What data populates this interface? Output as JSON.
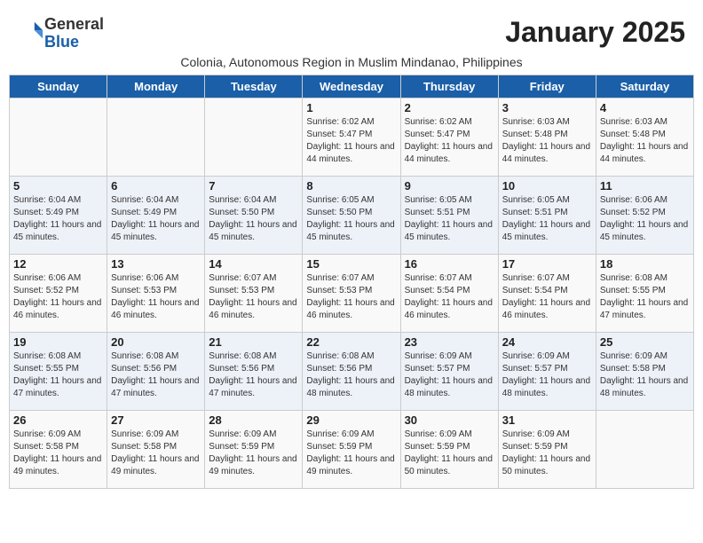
{
  "header": {
    "logo_line1": "General",
    "logo_line2": "Blue",
    "month_title": "January 2025",
    "subtitle": "Colonia, Autonomous Region in Muslim Mindanao, Philippines"
  },
  "weekdays": [
    "Sunday",
    "Monday",
    "Tuesday",
    "Wednesday",
    "Thursday",
    "Friday",
    "Saturday"
  ],
  "weeks": [
    [
      {
        "day": "",
        "sunrise": "",
        "sunset": "",
        "daylight": ""
      },
      {
        "day": "",
        "sunrise": "",
        "sunset": "",
        "daylight": ""
      },
      {
        "day": "",
        "sunrise": "",
        "sunset": "",
        "daylight": ""
      },
      {
        "day": "1",
        "sunrise": "6:02 AM",
        "sunset": "5:47 PM",
        "daylight": "11 hours and 44 minutes."
      },
      {
        "day": "2",
        "sunrise": "6:02 AM",
        "sunset": "5:47 PM",
        "daylight": "11 hours and 44 minutes."
      },
      {
        "day": "3",
        "sunrise": "6:03 AM",
        "sunset": "5:48 PM",
        "daylight": "11 hours and 44 minutes."
      },
      {
        "day": "4",
        "sunrise": "6:03 AM",
        "sunset": "5:48 PM",
        "daylight": "11 hours and 44 minutes."
      }
    ],
    [
      {
        "day": "5",
        "sunrise": "6:04 AM",
        "sunset": "5:49 PM",
        "daylight": "11 hours and 45 minutes."
      },
      {
        "day": "6",
        "sunrise": "6:04 AM",
        "sunset": "5:49 PM",
        "daylight": "11 hours and 45 minutes."
      },
      {
        "day": "7",
        "sunrise": "6:04 AM",
        "sunset": "5:50 PM",
        "daylight": "11 hours and 45 minutes."
      },
      {
        "day": "8",
        "sunrise": "6:05 AM",
        "sunset": "5:50 PM",
        "daylight": "11 hours and 45 minutes."
      },
      {
        "day": "9",
        "sunrise": "6:05 AM",
        "sunset": "5:51 PM",
        "daylight": "11 hours and 45 minutes."
      },
      {
        "day": "10",
        "sunrise": "6:05 AM",
        "sunset": "5:51 PM",
        "daylight": "11 hours and 45 minutes."
      },
      {
        "day": "11",
        "sunrise": "6:06 AM",
        "sunset": "5:52 PM",
        "daylight": "11 hours and 45 minutes."
      }
    ],
    [
      {
        "day": "12",
        "sunrise": "6:06 AM",
        "sunset": "5:52 PM",
        "daylight": "11 hours and 46 minutes."
      },
      {
        "day": "13",
        "sunrise": "6:06 AM",
        "sunset": "5:53 PM",
        "daylight": "11 hours and 46 minutes."
      },
      {
        "day": "14",
        "sunrise": "6:07 AM",
        "sunset": "5:53 PM",
        "daylight": "11 hours and 46 minutes."
      },
      {
        "day": "15",
        "sunrise": "6:07 AM",
        "sunset": "5:53 PM",
        "daylight": "11 hours and 46 minutes."
      },
      {
        "day": "16",
        "sunrise": "6:07 AM",
        "sunset": "5:54 PM",
        "daylight": "11 hours and 46 minutes."
      },
      {
        "day": "17",
        "sunrise": "6:07 AM",
        "sunset": "5:54 PM",
        "daylight": "11 hours and 46 minutes."
      },
      {
        "day": "18",
        "sunrise": "6:08 AM",
        "sunset": "5:55 PM",
        "daylight": "11 hours and 47 minutes."
      }
    ],
    [
      {
        "day": "19",
        "sunrise": "6:08 AM",
        "sunset": "5:55 PM",
        "daylight": "11 hours and 47 minutes."
      },
      {
        "day": "20",
        "sunrise": "6:08 AM",
        "sunset": "5:56 PM",
        "daylight": "11 hours and 47 minutes."
      },
      {
        "day": "21",
        "sunrise": "6:08 AM",
        "sunset": "5:56 PM",
        "daylight": "11 hours and 47 minutes."
      },
      {
        "day": "22",
        "sunrise": "6:08 AM",
        "sunset": "5:56 PM",
        "daylight": "11 hours and 48 minutes."
      },
      {
        "day": "23",
        "sunrise": "6:09 AM",
        "sunset": "5:57 PM",
        "daylight": "11 hours and 48 minutes."
      },
      {
        "day": "24",
        "sunrise": "6:09 AM",
        "sunset": "5:57 PM",
        "daylight": "11 hours and 48 minutes."
      },
      {
        "day": "25",
        "sunrise": "6:09 AM",
        "sunset": "5:58 PM",
        "daylight": "11 hours and 48 minutes."
      }
    ],
    [
      {
        "day": "26",
        "sunrise": "6:09 AM",
        "sunset": "5:58 PM",
        "daylight": "11 hours and 49 minutes."
      },
      {
        "day": "27",
        "sunrise": "6:09 AM",
        "sunset": "5:58 PM",
        "daylight": "11 hours and 49 minutes."
      },
      {
        "day": "28",
        "sunrise": "6:09 AM",
        "sunset": "5:59 PM",
        "daylight": "11 hours and 49 minutes."
      },
      {
        "day": "29",
        "sunrise": "6:09 AM",
        "sunset": "5:59 PM",
        "daylight": "11 hours and 49 minutes."
      },
      {
        "day": "30",
        "sunrise": "6:09 AM",
        "sunset": "5:59 PM",
        "daylight": "11 hours and 50 minutes."
      },
      {
        "day": "31",
        "sunrise": "6:09 AM",
        "sunset": "5:59 PM",
        "daylight": "11 hours and 50 minutes."
      },
      {
        "day": "",
        "sunrise": "",
        "sunset": "",
        "daylight": ""
      }
    ]
  ]
}
